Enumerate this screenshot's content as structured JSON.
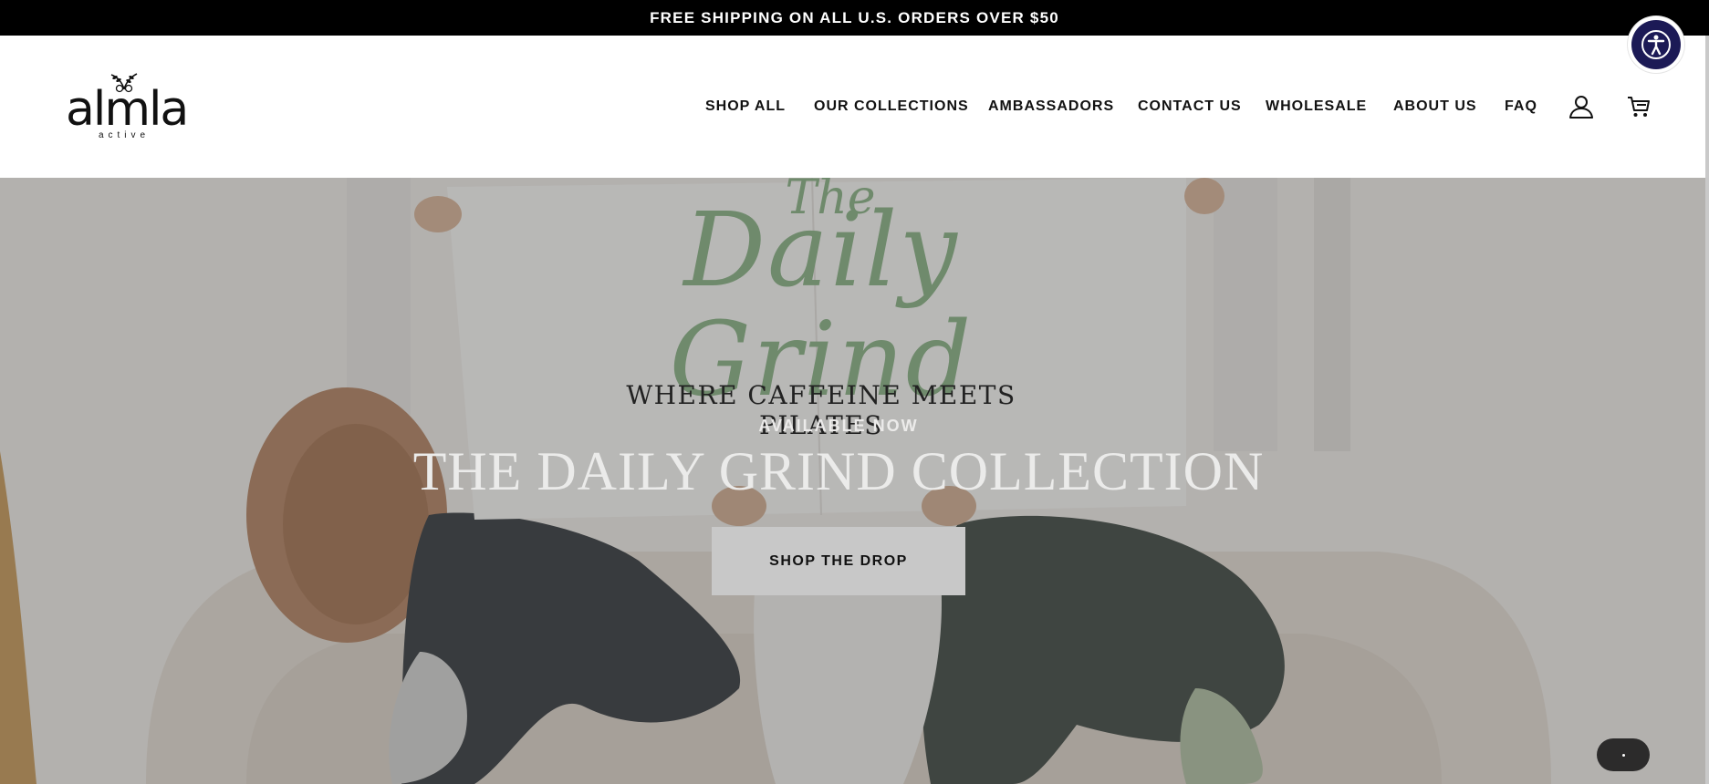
{
  "announcement": {
    "text": "FREE SHIPPING ON ALL U.S. ORDERS OVER $50"
  },
  "logo": {
    "wordmark": "almla",
    "subtext": "active"
  },
  "nav": {
    "items": [
      {
        "label": "SHOP ALL"
      },
      {
        "label": "OUR COLLECTIONS"
      },
      {
        "label": "AMBASSADORS"
      },
      {
        "label": "CONTACT US"
      },
      {
        "label": "WHOLESALE"
      },
      {
        "label": "ABOUT US"
      },
      {
        "label": "FAQ"
      }
    ],
    "account_icon": "user-icon",
    "cart_icon": "cart-icon"
  },
  "accessibility": {
    "icon": "accessibility-icon"
  },
  "hero": {
    "sign_the": "The",
    "sign_script": "Daily Grind",
    "sign_tagline": "WHERE CAFFEINE MEETS PILATES",
    "kicker": "AVAILABLE NOW",
    "title": "THE DAILY GRIND COLLECTION",
    "cta_label": "SHOP THE DROP"
  },
  "chat": {
    "icon": "chat-icon"
  },
  "colors": {
    "announcement_bg": "#000000",
    "accessibility_bg": "#1c1a56",
    "sign_script": "#6f8a6c",
    "cta_bg": "#c8c8c8"
  }
}
